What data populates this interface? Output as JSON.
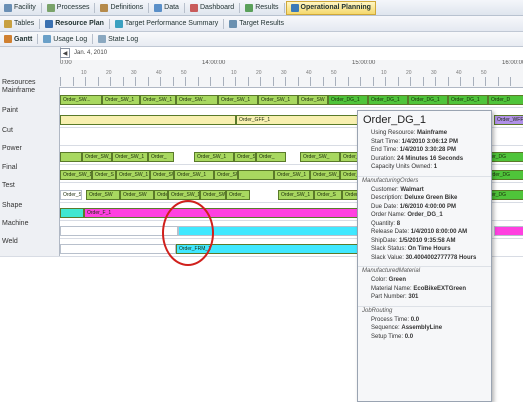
{
  "menubar": {
    "items": [
      {
        "label": "Facility",
        "icon": "facility-icon",
        "color": "#6a8fb5"
      },
      {
        "label": "Processes",
        "icon": "processes-icon",
        "color": "#7aa36a"
      },
      {
        "label": "Definitions",
        "icon": "definitions-icon",
        "color": "#b58a4a"
      },
      {
        "label": "Data",
        "icon": "data-icon",
        "color": "#5a8fc8"
      },
      {
        "label": "Dashboard",
        "icon": "dashboard-icon",
        "color": "#c85a5a"
      },
      {
        "label": "Results",
        "icon": "results-icon",
        "color": "#5aa05a"
      },
      {
        "label": "Operational Planning",
        "icon": "operational-planning-icon",
        "color": "#3a7ab8"
      }
    ]
  },
  "subbar": {
    "items": [
      {
        "label": "Tables",
        "icon": "tables-icon",
        "color": "#c8a040"
      },
      {
        "label": "Resource Plan",
        "icon": "resource-plan-icon",
        "color": "#3a70b0"
      },
      {
        "label": "Target Performance Summary",
        "icon": "target-summary-icon",
        "color": "#3aa0c0"
      },
      {
        "label": "Target Results",
        "icon": "target-results-icon",
        "color": "#6a90b0"
      }
    ]
  },
  "viewbar": {
    "items": [
      {
        "label": "Gantt",
        "icon": "gantt-icon",
        "color": "#d08030"
      },
      {
        "label": "Usage Log",
        "icon": "usage-log-icon",
        "color": "#6aa0c8"
      },
      {
        "label": "State Log",
        "icon": "state-log-icon",
        "color": "#8aa8c0"
      }
    ]
  },
  "gantt": {
    "date_label": "Jan. 4, 2010",
    "resources_header": "Resources",
    "hours": [
      "0:00",
      "14:00:00",
      "15:00:00",
      "16:00:00"
    ],
    "minutes": [
      "10",
      "20",
      "30",
      "40",
      "50",
      "10",
      "20",
      "30",
      "40",
      "50",
      "10",
      "20",
      "30",
      "40",
      "50",
      "10",
      "20",
      "30",
      "40",
      "50"
    ],
    "rows": [
      {
        "name": "Mainframe",
        "color": "#a8d860",
        "segs": [
          {
            "l": 0,
            "w": 42,
            "t": "Order_SW..."
          },
          {
            "l": 42,
            "w": 38,
            "t": "Order_SW_1"
          },
          {
            "l": 80,
            "w": 36,
            "t": "Order_SW_1"
          },
          {
            "l": 116,
            "w": 42,
            "t": "Order_SW..."
          },
          {
            "l": 158,
            "w": 40,
            "t": "Order_SW_1"
          },
          {
            "l": 198,
            "w": 40,
            "t": "Order_SW_1"
          },
          {
            "l": 238,
            "w": 30,
            "t": "Order_SW"
          },
          {
            "l": 268,
            "w": 40,
            "t": "Order_DG_1",
            "c": "#4fc43a"
          },
          {
            "l": 308,
            "w": 40,
            "t": "Order_DG_1",
            "c": "#4fc43a"
          },
          {
            "l": 348,
            "w": 40,
            "t": "Order_DG_1",
            "c": "#4fc43a"
          },
          {
            "l": 388,
            "w": 40,
            "t": "Order_DG_1",
            "c": "#4fc43a"
          },
          {
            "l": 428,
            "w": 40,
            "t": "Order_D",
            "c": "#4fc43a"
          }
        ]
      },
      {
        "name": "Paint",
        "color": "#f8f0b0",
        "segs": [
          {
            "l": 0,
            "w": 176,
            "t": ""
          },
          {
            "l": 176,
            "w": 128,
            "t": "Order_GFF_1"
          },
          {
            "l": 434,
            "w": 40,
            "t": "Order_WFF_",
            "c": "#b090e8"
          }
        ]
      },
      {
        "name": "Cut",
        "color": "#ffffff",
        "segs": []
      },
      {
        "name": "Power",
        "color": "#a8d860",
        "segs": [
          {
            "l": 0,
            "w": 22,
            "t": ""
          },
          {
            "l": 22,
            "w": 30,
            "t": "Order_SW_"
          },
          {
            "l": 52,
            "w": 36,
            "t": "Order_SW_1"
          },
          {
            "l": 88,
            "w": 26,
            "t": "Order_"
          },
          {
            "l": 134,
            "w": 40,
            "t": "Order_SW_1"
          },
          {
            "l": 174,
            "w": 22,
            "t": "Order_S"
          },
          {
            "l": 196,
            "w": 30,
            "t": "Order_"
          },
          {
            "l": 240,
            "w": 40,
            "t": "Order_SW_"
          },
          {
            "l": 280,
            "w": 40,
            "t": "Order_SW_1"
          },
          {
            "l": 420,
            "w": 48,
            "t": "Order_DG",
            "c": "#4fc43a"
          }
        ]
      },
      {
        "name": "Final",
        "color": "#a8d860",
        "segs": [
          {
            "l": 0,
            "w": 32,
            "t": "Order_SW_1"
          },
          {
            "l": 32,
            "w": 24,
            "t": "Order_S"
          },
          {
            "l": 56,
            "w": 34,
            "t": "Order_SW_1"
          },
          {
            "l": 90,
            "w": 24,
            "t": "Order_SW"
          },
          {
            "l": 114,
            "w": 40,
            "t": "Order_SW_1"
          },
          {
            "l": 154,
            "w": 24,
            "t": "Order_SW"
          },
          {
            "l": 178,
            "w": 36,
            "t": ""
          },
          {
            "l": 214,
            "w": 36,
            "t": "Order_SW_1"
          },
          {
            "l": 250,
            "w": 30,
            "t": "Order_SW_"
          },
          {
            "l": 280,
            "w": 24,
            "t": "Order_"
          },
          {
            "l": 424,
            "w": 44,
            "t": "Order_DG",
            "c": "#4fc43a"
          }
        ]
      },
      {
        "name": "Test",
        "color": "#a8d860",
        "segs": [
          {
            "l": 0,
            "w": 22,
            "t": "Order_SG",
            "c": "#ffffff"
          },
          {
            "l": 26,
            "w": 34,
            "t": "Order_SW"
          },
          {
            "l": 60,
            "w": 34,
            "t": "Order_SW"
          },
          {
            "l": 94,
            "w": 14,
            "t": "Order_"
          },
          {
            "l": 108,
            "w": 32,
            "t": "Order_SW_1"
          },
          {
            "l": 140,
            "w": 26,
            "t": "Order_SW"
          },
          {
            "l": 166,
            "w": 24,
            "t": "Order_"
          },
          {
            "l": 218,
            "w": 36,
            "t": "Order_SW_1"
          },
          {
            "l": 254,
            "w": 28,
            "t": "Order_S"
          },
          {
            "l": 282,
            "w": 22,
            "t": "Order"
          },
          {
            "l": 420,
            "w": 48,
            "t": "Order_DG",
            "c": "#4fc43a"
          }
        ]
      },
      {
        "name": "Shape",
        "color": "#ff40e0",
        "segs": [
          {
            "l": 0,
            "w": 24,
            "t": "",
            "c": "#40e8d0"
          },
          {
            "l": 24,
            "w": 280,
            "t": "Order_F_1"
          }
        ]
      },
      {
        "name": "Machine",
        "color": "#ffffff",
        "segs": [
          {
            "l": 0,
            "w": 118,
            "t": "",
            "c": "#ffffff"
          },
          {
            "l": 118,
            "w": 186,
            "t": "",
            "c": "#40e8ff"
          },
          {
            "l": 434,
            "w": 34,
            "t": "",
            "c": "#ff40e0"
          }
        ]
      },
      {
        "name": "Weld",
        "color": "#40e8ff",
        "segs": [
          {
            "l": 0,
            "w": 116,
            "t": "",
            "c": "#ffffff"
          },
          {
            "l": 116,
            "w": 188,
            "t": "Order_FRM_1"
          }
        ]
      }
    ]
  },
  "tooltip": {
    "title": "Order_DG_1",
    "lines1": [
      [
        "Using Resource: ",
        "Mainframe"
      ],
      [
        "Start Time: ",
        "1/4/2010 3:06:12 PM"
      ],
      [
        "End Time: ",
        "1/4/2010 3:30:28 PM"
      ],
      [
        "Duration: ",
        "24 Minutes 16 Seconds"
      ],
      [
        "Capacity Units Owned: ",
        "1"
      ]
    ],
    "section2": "ManufacturingOrders",
    "lines2": [
      [
        "Customer: ",
        "Walmart"
      ],
      [
        "Description: ",
        "Deluxe Green Bike"
      ],
      [
        "Due Date: ",
        "1/6/2010 4:00:00 PM"
      ],
      [
        "Order Name: ",
        "Order_DG_1"
      ],
      [
        "Quantity: ",
        "8"
      ],
      [
        "Release Date: ",
        "1/4/2010 8:00:00 AM"
      ],
      [
        "ShipDate: ",
        "1/5/2010 9:35:58 AM"
      ],
      [
        "Slack Status: ",
        "On Time Hours"
      ],
      [
        "Slack Value: ",
        "30.4004002777778 Hours"
      ]
    ],
    "section3": "ManufacturedMaterial",
    "lines3": [
      [
        "Color: ",
        "Green"
      ],
      [
        "Material Name: ",
        "EcoBikeEXTGreen"
      ],
      [
        "Part Number: ",
        "301"
      ]
    ],
    "section4": "JobRouting",
    "lines4": [
      [
        "Process Time: ",
        "0.0"
      ],
      [
        "Sequence: ",
        "AssemblyLine"
      ],
      [
        "Setup Time: ",
        "0.0"
      ]
    ]
  }
}
